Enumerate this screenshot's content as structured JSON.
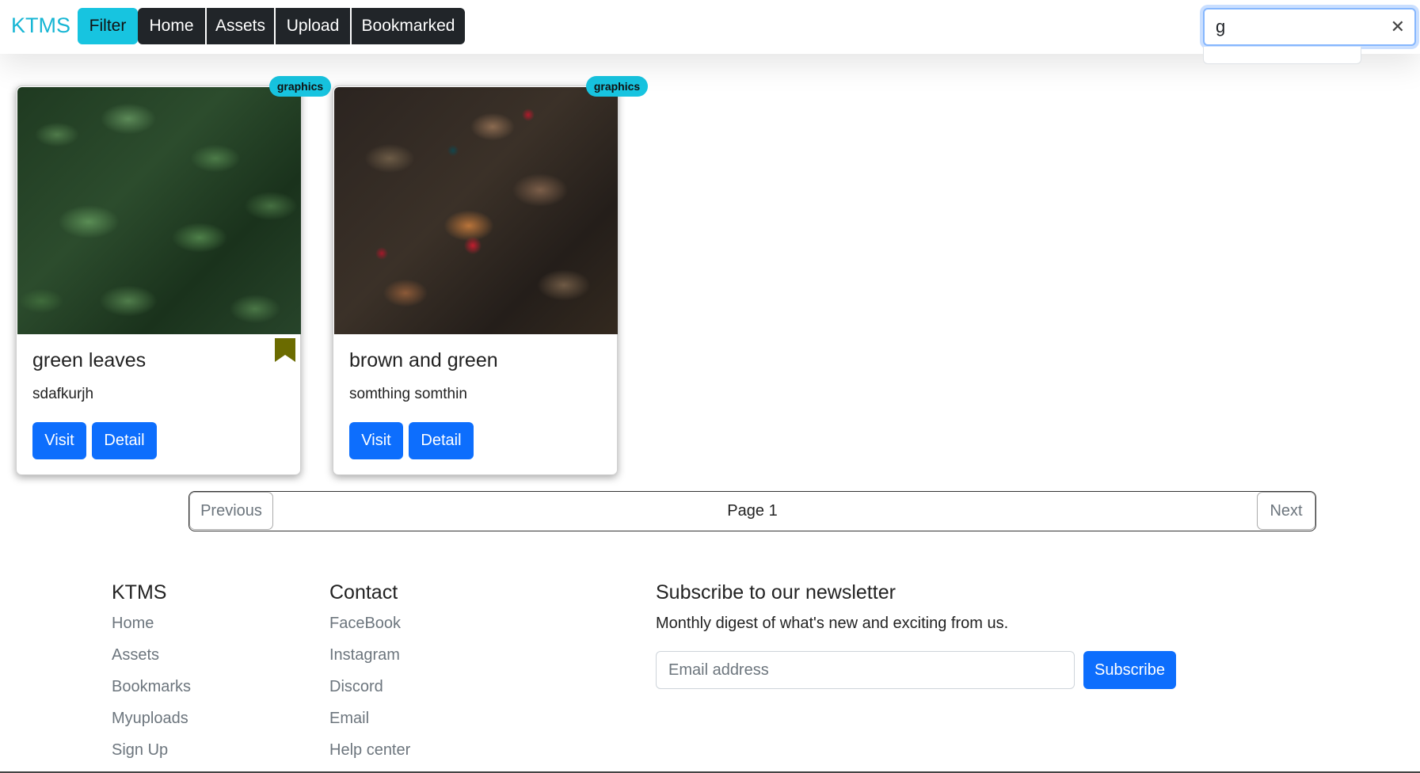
{
  "navbar": {
    "brand": "KTMS",
    "buttons": {
      "filter": "Filter",
      "home": "Home",
      "assets": "Assets",
      "upload": "Upload",
      "bookmarked": "Bookmarked"
    },
    "search": {
      "value": "g",
      "clear_icon": "close-icon"
    }
  },
  "cards": [
    {
      "badge": "graphics",
      "title": "green leaves",
      "text": "sdafkurjh",
      "visit": "Visit",
      "detail": "Detail",
      "bookmarked": true,
      "bookmark_color": "#6b6b00"
    },
    {
      "badge": "graphics",
      "title": "brown and green",
      "text": "somthing somthin",
      "visit": "Visit",
      "detail": "Detail",
      "bookmarked": false
    }
  ],
  "pagination": {
    "previous": "Previous",
    "page_label": "Page 1",
    "next": "Next"
  },
  "footer": {
    "col1": {
      "title": "KTMS",
      "links": [
        "Home",
        "Assets",
        "Bookmarks",
        "Myuploads",
        "Sign Up"
      ]
    },
    "col2": {
      "title": "Contact",
      "links": [
        "FaceBook",
        "Instagram",
        "Discord",
        "Email",
        "Help center"
      ]
    },
    "newsletter": {
      "title": "Subscribe to our newsletter",
      "description": "Monthly digest of what's new and exciting from us.",
      "placeholder": "Email address",
      "button": "Subscribe"
    }
  },
  "colors": {
    "accent": "#17c4e0",
    "primary": "#0d6efd",
    "dark": "#212529"
  }
}
